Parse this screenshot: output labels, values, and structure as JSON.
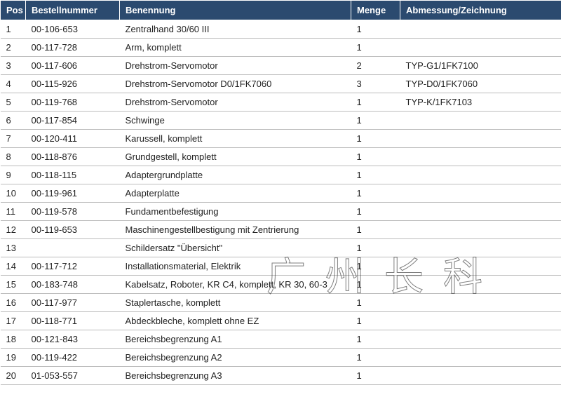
{
  "headers": {
    "pos": "Pos",
    "order": "Bestellnummer",
    "name": "Benennung",
    "qty": "Menge",
    "dim": "Abmessung/Zeichnung"
  },
  "rows": [
    {
      "pos": "1",
      "order": "00-106-653",
      "name": "Zentralhand 30/60 III",
      "qty": "1",
      "dim": ""
    },
    {
      "pos": "2",
      "order": "00-117-728",
      "name": "Arm, komplett",
      "qty": "1",
      "dim": ""
    },
    {
      "pos": "3",
      "order": "00-117-606",
      "name": "Drehstrom-Servomotor",
      "qty": "2",
      "dim": "TYP-G1/1FK7100"
    },
    {
      "pos": "4",
      "order": "00-115-926",
      "name": "Drehstrom-Servomotor D0/1FK7060",
      "qty": "3",
      "dim": "TYP-D0/1FK7060"
    },
    {
      "pos": "5",
      "order": "00-119-768",
      "name": "Drehstrom-Servomotor",
      "qty": "1",
      "dim": "TYP-K/1FK7103"
    },
    {
      "pos": "6",
      "order": "00-117-854",
      "name": "Schwinge",
      "qty": "1",
      "dim": ""
    },
    {
      "pos": "7",
      "order": "00-120-411",
      "name": "Karussell, komplett",
      "qty": "1",
      "dim": ""
    },
    {
      "pos": "8",
      "order": "00-118-876",
      "name": "Grundgestell, komplett",
      "qty": "1",
      "dim": ""
    },
    {
      "pos": "9",
      "order": "00-118-115",
      "name": "Adaptergrundplatte",
      "qty": "1",
      "dim": ""
    },
    {
      "pos": "10",
      "order": "00-119-961",
      "name": "Adapterplatte",
      "qty": "1",
      "dim": ""
    },
    {
      "pos": "11",
      "order": "00-119-578",
      "name": "Fundamentbefestigung",
      "qty": "1",
      "dim": ""
    },
    {
      "pos": "12",
      "order": "00-119-653",
      "name": "Maschinengestellbestigung mit Zentrierung",
      "qty": "1",
      "dim": ""
    },
    {
      "pos": "13",
      "order": "",
      "name": "Schildersatz \"Übersicht\"",
      "qty": "1",
      "dim": ""
    },
    {
      "pos": "14",
      "order": "00-117-712",
      "name": "Installationsmaterial, Elektrik",
      "qty": "1",
      "dim": ""
    },
    {
      "pos": "15",
      "order": "00-183-748",
      "name": "Kabelsatz, Roboter, KR C4, komplett, KR 30, 60-3",
      "qty": "1",
      "dim": ""
    },
    {
      "pos": "16",
      "order": "00-117-977",
      "name": "Staplertasche, komplett",
      "qty": "1",
      "dim": ""
    },
    {
      "pos": "17",
      "order": "00-118-771",
      "name": "Abdeckbleche, komplett ohne EZ",
      "qty": "1",
      "dim": ""
    },
    {
      "pos": "18",
      "order": "00-121-843",
      "name": "Bereichsbegrenzung A1",
      "qty": "1",
      "dim": ""
    },
    {
      "pos": "19",
      "order": "00-119-422",
      "name": "Bereichsbegrenzung A2",
      "qty": "1",
      "dim": ""
    },
    {
      "pos": "20",
      "order": "01-053-557",
      "name": "Bereichsbegrenzung A3",
      "qty": "1",
      "dim": ""
    }
  ],
  "watermark": "广州长科"
}
